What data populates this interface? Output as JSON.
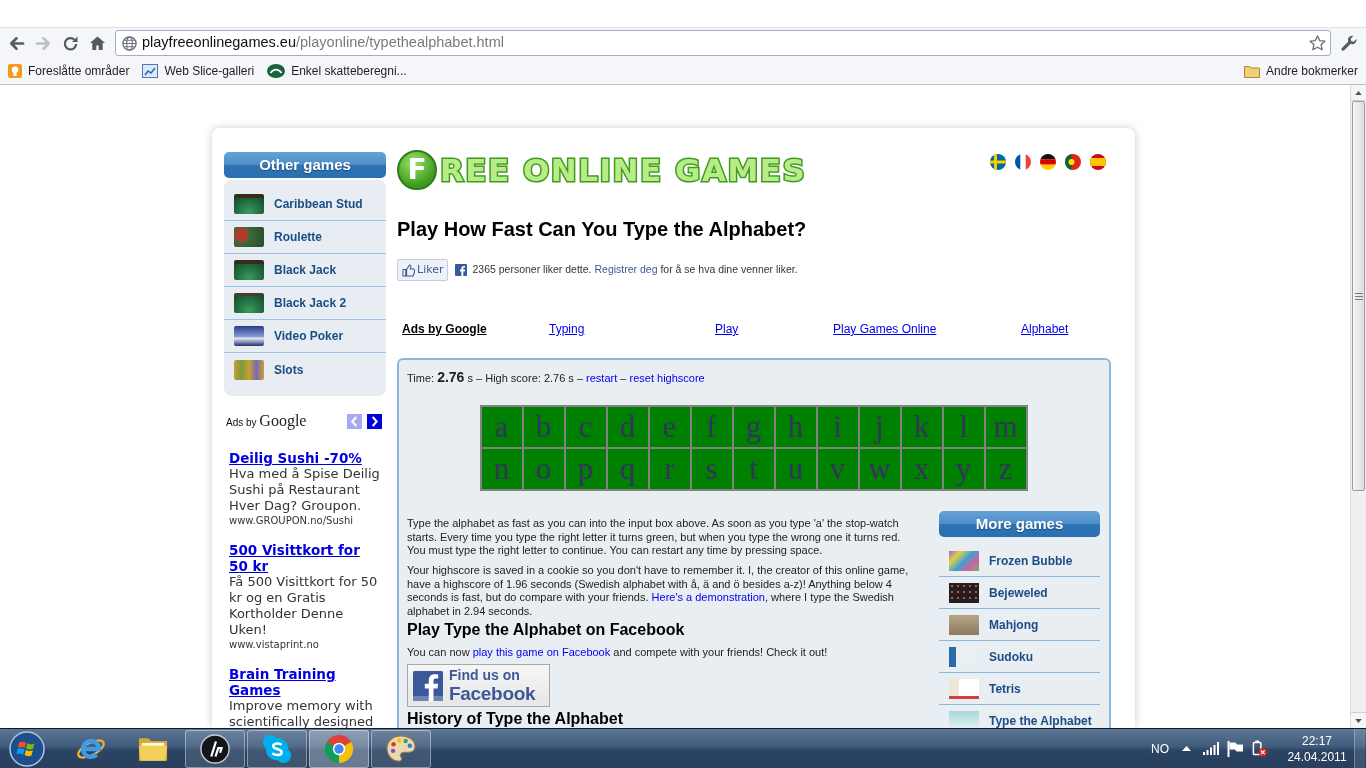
{
  "browser": {
    "nav_buttons": [
      {
        "kind": "back",
        "disabled": false
      },
      {
        "kind": "forward",
        "disabled": true
      },
      {
        "kind": "reload",
        "disabled": false
      },
      {
        "kind": "home",
        "disabled": false
      }
    ],
    "url_domain": "playfreeonlinegames.eu",
    "url_path": "/playonline/typethealphabet.html",
    "bookmarks": [
      "Foreslåtte områder",
      "Web Slice-galleri",
      "Enkel skatteberegni..."
    ],
    "other_bookmarks": "Andre bokmerker"
  },
  "sidebar": {
    "title": "Other games",
    "games": [
      "Caribbean Stud",
      "Roulette",
      "Black Jack",
      "Black Jack 2",
      "Video Poker",
      "Slots"
    ],
    "ads_label": "Ads by",
    "ads_brand": "Google",
    "ads_pager": [
      {
        "kind": "previous",
        "disabled": true
      },
      {
        "kind": "next",
        "disabled": false
      }
    ],
    "ads": [
      {
        "title": "Deilig Sushi -70%",
        "text": "Hva med å Spise Deilig Sushi på Restaurant Hver Dag? Groupon.",
        "url": "www.GROUPON.no/Sushi"
      },
      {
        "title": "500 Visittkort for 50 kr",
        "text": "Få 500 Visittkort for 50 kr og en Gratis Kortholder Denne Uken!",
        "url": "www.vistaprint.no"
      },
      {
        "title": "Brain Training Games",
        "text": "Improve memory with scientifically designed"
      }
    ]
  },
  "header": {
    "logo_initial": "F",
    "logo_text": "REE ONLINE GAMES"
  },
  "title": "Play How Fast Can You Type the Alphabet?",
  "like": {
    "button": "Liker",
    "count": "2365 personer liker dette.",
    "link": "Registrer deg",
    "rest": "for å se hva dine venner liker."
  },
  "ad_links": [
    {
      "kind": "label",
      "text": "Ads by Google"
    },
    {
      "kind": "link",
      "text": "Typing"
    },
    {
      "kind": "link",
      "text": "Play"
    },
    {
      "kind": "link",
      "text": "Play Games Online"
    },
    {
      "kind": "link",
      "text": "Alphabet"
    }
  ],
  "game": {
    "score": "Time: **2.76** s – High score: 2.76 s –",
    "links": [
      "restart",
      "reset highscore"
    ],
    "separator": "–",
    "letters": [
      {
        "char": "a",
        "correct": true
      },
      {
        "char": "b",
        "correct": true
      },
      {
        "char": "c",
        "correct": true
      },
      {
        "char": "d",
        "correct": true
      },
      {
        "char": "e",
        "correct": true
      },
      {
        "char": "f",
        "correct": true
      },
      {
        "char": "g",
        "correct": true
      },
      {
        "char": "h",
        "correct": true
      },
      {
        "char": "i",
        "correct": true
      },
      {
        "char": "j",
        "correct": true
      },
      {
        "char": "k",
        "correct": true
      },
      {
        "char": "l",
        "correct": true
      },
      {
        "char": "m",
        "correct": true
      },
      {
        "char": "n",
        "correct": true
      },
      {
        "char": "o",
        "correct": true
      },
      {
        "char": "p",
        "correct": true
      },
      {
        "char": "q",
        "correct": true
      },
      {
        "char": "r",
        "correct": true
      },
      {
        "char": "s",
        "correct": true
      },
      {
        "char": "t",
        "correct": true
      },
      {
        "char": "u",
        "correct": true
      },
      {
        "char": "v",
        "correct": true
      },
      {
        "char": "w",
        "correct": true
      },
      {
        "char": "x",
        "correct": true
      },
      {
        "char": "y",
        "correct": true
      },
      {
        "char": "z",
        "correct": true
      }
    ]
  },
  "content": [
    {
      "kind": "paragraph",
      "text": "Type the alphabet as fast as you can into the input box above. As soon as you type 'a' the stop-watch starts. Every time you type the right letter it turns green, but when you type the wrong one it turns red. You must type the right letter to continue. You can restart any time by pressing space."
    },
    {
      "kind": "paragraph",
      "text": "Your highscore is saved in a cookie so you don't have to remember it. I, the creator of this online game, have a highscore of 1.96 seconds (Swedish alphabet with å, ä and ö besides a-z)! Anything below 4 seconds is fast, but do compare with your friends.",
      "link": "Here's a demonstration",
      "after": ", where I type the Swedish alphabet in 2.94 seconds."
    },
    {
      "kind": "heading",
      "text": "Play Type the Alphabet on Facebook"
    },
    {
      "kind": "paragraph",
      "text": "You can now",
      "link": "play this game on Facebook",
      "after": " and compete with your friends! Check it out!"
    },
    {
      "kind": "facebook_badge",
      "line1": "Find us on",
      "line2": "Facebook"
    },
    {
      "kind": "heading",
      "text": "History of Type the Alphabet"
    }
  ],
  "more_games": {
    "title": "More games",
    "games": [
      "Frozen Bubble",
      "Bejeweled",
      "Mahjong",
      "Sudoku",
      "Tetris",
      "Type the Alphabet"
    ]
  },
  "taskbar": {
    "apps": [
      {
        "kind": "e_logo",
        "running": false,
        "selected": false
      },
      {
        "kind": "folder",
        "running": false,
        "selected": false
      },
      {
        "kind": "round_logo",
        "running": true,
        "selected": false
      },
      {
        "kind": "cloud_logo",
        "running": true,
        "selected": false
      },
      {
        "kind": "circle_logo",
        "running": true,
        "selected": true
      },
      {
        "kind": "palette",
        "running": true,
        "selected": false
      }
    ],
    "language": "NO",
    "time": "22:17",
    "date": "24.04.2011"
  }
}
